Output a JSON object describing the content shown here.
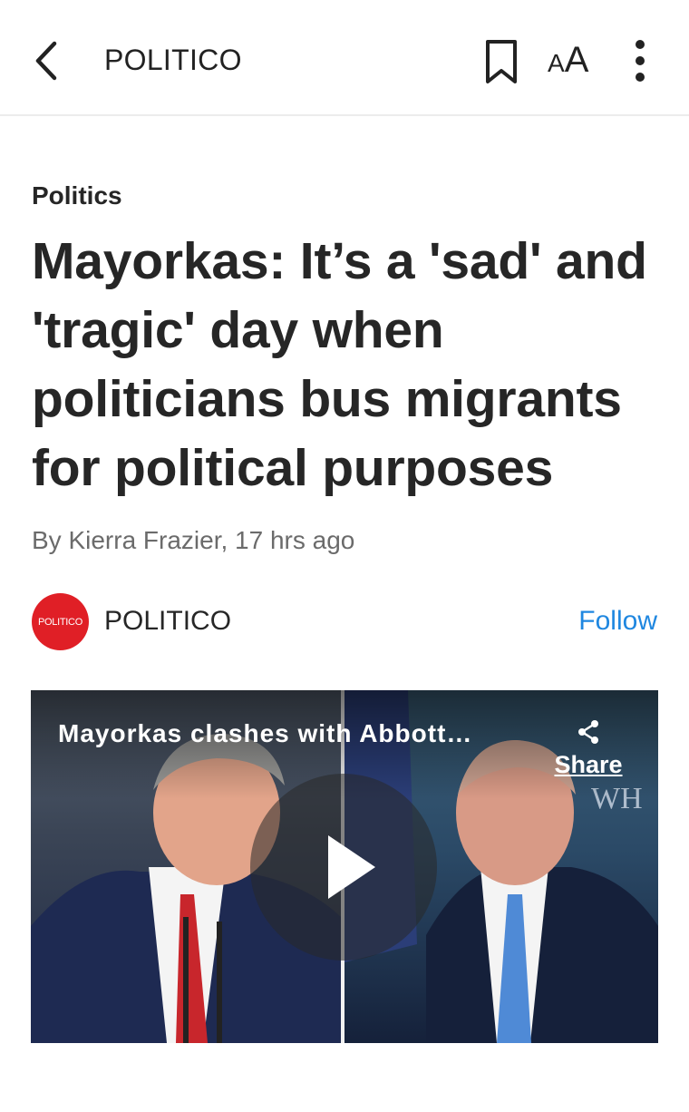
{
  "topbar": {
    "title": "POLITICO",
    "textsize_label_small": "A",
    "textsize_label_large": "A"
  },
  "article": {
    "category": "Politics",
    "headline": "Mayorkas: It’s a 'sad' and 'tragic' day when politicians bus migrants for political purposes",
    "byline": "By Kierra Frazier, 17 hrs ago"
  },
  "source": {
    "logo_text": "POLITICO",
    "name": "POLITICO",
    "follow_label": "Follow"
  },
  "video": {
    "title": "Mayorkas clashes with Abbott…",
    "share_label": "Share"
  },
  "colors": {
    "accent_follow": "#1f87e0",
    "brand_red": "#e01f26"
  },
  "icons": [
    "back-arrow-icon",
    "bookmark-icon",
    "text-size-icon",
    "more-vert-icon",
    "share-icon",
    "play-icon"
  ]
}
